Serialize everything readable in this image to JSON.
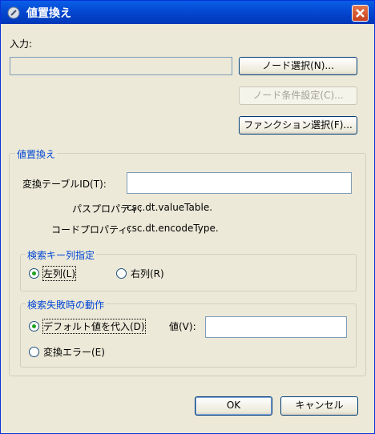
{
  "window": {
    "title": "値置換え"
  },
  "input_section": {
    "label": "入力:",
    "value": ""
  },
  "buttons": {
    "node_select": "ノード選択(N)...",
    "node_condition": "ノード条件設定(C)...",
    "function_select": "ファンクション選択(F)..."
  },
  "replace_group": {
    "title": "値置換え",
    "table_id_label": "変換テーブルID(T):",
    "table_id_value": "",
    "path_property_label": "パスプロパティ:",
    "path_property_value": "csc.dt.valueTable.",
    "code_property_label": "コードプロパティ:",
    "code_property_value": "csc.dt.encodeType."
  },
  "key_column_group": {
    "title": "検索キー列指定",
    "left_label": "左列(L)",
    "right_label": "右列(R)",
    "selected": "left"
  },
  "failure_group": {
    "title": "検索失敗時の動作",
    "default_label": "デフォルト値を代入(D)",
    "value_label": "値(V):",
    "value": "",
    "error_label": "変換エラー(E)",
    "selected": "default"
  },
  "footer": {
    "ok": "OK",
    "cancel": "キャンセル"
  }
}
